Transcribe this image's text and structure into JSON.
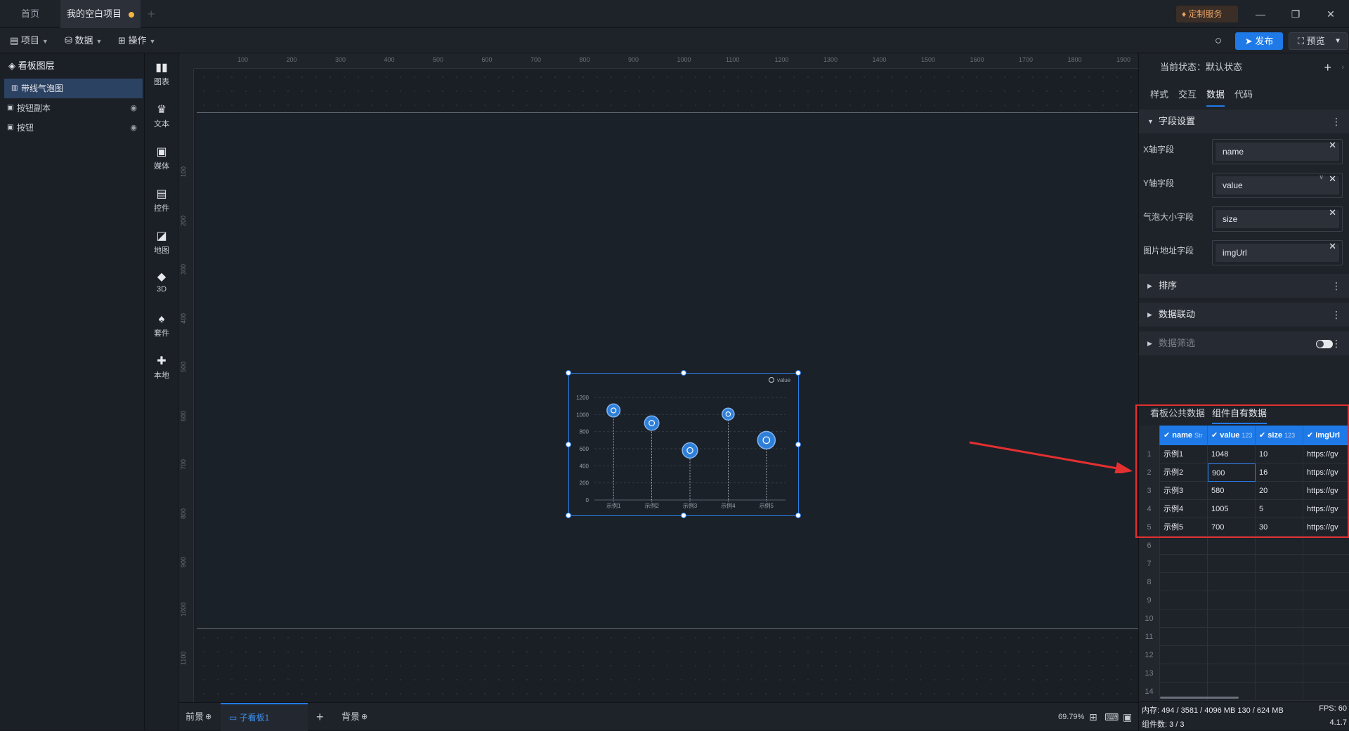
{
  "tabs": [
    {
      "label": "首页"
    },
    {
      "label": "我的空白项目"
    }
  ],
  "custom_service": "定制服务",
  "toolbar": {
    "project": "项目",
    "data": "数据",
    "operate": "操作",
    "publish": "发布",
    "preview": "预览"
  },
  "layers": {
    "title": "看板图层",
    "items": [
      {
        "label": "带线气泡图"
      },
      {
        "label": "按钮副本"
      },
      {
        "label": "按钮"
      }
    ]
  },
  "components": [
    {
      "label": "图表",
      "icon": "bar-chart-icon"
    },
    {
      "label": "文本",
      "icon": "text-icon"
    },
    {
      "label": "媒体",
      "icon": "media-icon"
    },
    {
      "label": "控件",
      "icon": "widget-icon"
    },
    {
      "label": "地图",
      "icon": "map-icon"
    },
    {
      "label": "3D",
      "icon": "cube-icon"
    },
    {
      "label": "套件",
      "icon": "shirt-icon"
    },
    {
      "label": "本地",
      "icon": "puzzle-icon"
    }
  ],
  "ruler": {
    "h": [
      "100",
      "200",
      "300",
      "400",
      "500",
      "600",
      "700",
      "800",
      "900",
      "1000",
      "1100",
      "1200",
      "1300",
      "1400",
      "1500",
      "1600",
      "1700",
      "1800",
      "1900"
    ],
    "v": [
      "100",
      "200",
      "300",
      "400",
      "500",
      "600",
      "700",
      "800",
      "900",
      "1000",
      "1100"
    ]
  },
  "chart_data": {
    "type": "scatter",
    "legend": "value",
    "legend_position": "top-right",
    "categories": [
      "示例1",
      "示例2",
      "示例3",
      "示例4",
      "示例5"
    ],
    "values": [
      1048,
      900,
      580,
      1005,
      700
    ],
    "sizes": [
      10,
      16,
      20,
      5,
      30
    ],
    "ylim": [
      0,
      1200
    ],
    "yticks": [
      "0",
      "200",
      "400",
      "600",
      "800",
      "1000",
      "1200"
    ],
    "grid": true,
    "drop_lines": true,
    "colors": {
      "bubble": "#2f7fd8",
      "axis": "#5a606a"
    }
  },
  "bottom": {
    "foreground": "前景",
    "subboard": "子看板1",
    "background": "背景",
    "zoom": "69.79%"
  },
  "panel": {
    "state": "当前状态：默认状态",
    "tabs": [
      "样式",
      "交互",
      "数据",
      "代码"
    ],
    "active_tab": "数据",
    "field_section": "字段设置",
    "fields": [
      {
        "label": "X轴字段",
        "value": "name"
      },
      {
        "label": "Y轴字段",
        "value": "value"
      },
      {
        "label": "气泡大小字段",
        "value": "size"
      },
      {
        "label": "图片地址字段",
        "value": "imgUrl"
      }
    ],
    "sections": [
      "排序",
      "数据联动",
      "数据筛选"
    ],
    "data_tabs": [
      "看板公共数据",
      "组件自有数据"
    ],
    "columns": [
      {
        "name": "name",
        "type": "Str"
      },
      {
        "name": "value",
        "type": "123"
      },
      {
        "name": "size",
        "type": "123"
      },
      {
        "name": "imgUrl",
        "type": ""
      }
    ],
    "row_numbers": [
      "1",
      "2",
      "3",
      "4",
      "5",
      "6",
      "7",
      "8",
      "9",
      "10",
      "11",
      "12",
      "13",
      "14"
    ],
    "rows": [
      [
        "示例1",
        "1048",
        "10",
        "https://gv"
      ],
      [
        "示例2",
        "900",
        "16",
        "https://gv"
      ],
      [
        "示例3",
        "580",
        "20",
        "https://gv"
      ],
      [
        "示例4",
        "1005",
        "5",
        "https://gv"
      ],
      [
        "示例5",
        "700",
        "30",
        "https://gv"
      ]
    ],
    "status": {
      "memory": "内存:  494 / 3581 / 4096 MB  130 / 624 MB",
      "fps": "FPS:  60",
      "components": "组件数: 3 / 3",
      "version": "4.1.7"
    }
  }
}
